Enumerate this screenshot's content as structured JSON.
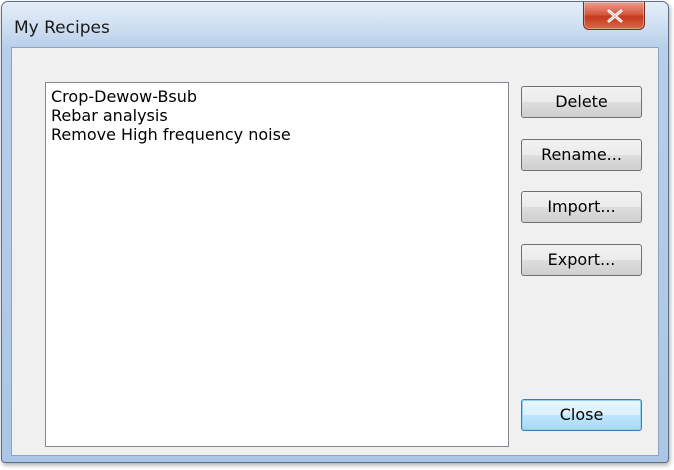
{
  "window": {
    "title": "My Recipes"
  },
  "recipes": {
    "items": [
      "Crop-Dewow-Bsub",
      "Rebar analysis",
      "Remove High frequency noise"
    ]
  },
  "buttons": {
    "delete": "Delete",
    "rename": "Rename...",
    "import": "Import...",
    "export": "Export...",
    "close": "Close"
  },
  "icons": {
    "title_close": "close-x-icon"
  },
  "colors": {
    "close_button_red": "#c4391d",
    "default_button_border": "#3c7fb1"
  }
}
